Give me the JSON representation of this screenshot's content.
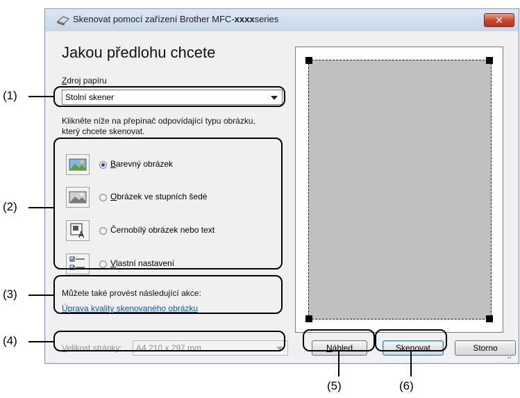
{
  "window": {
    "title_prefix": "Skenovat pomocí zařízení Brother MFC-",
    "title_model": "xxxx",
    "title_suffix": "series",
    "close_glyph": "✕"
  },
  "heading": "Jakou předlohu chcete",
  "paper_source": {
    "label": "Zdroj papíru",
    "selected": "Stolní skener"
  },
  "instruction": {
    "line1": "Klikněte níže na přepínač odpovídající typu obrázku,",
    "line2": "který chcete skenovat."
  },
  "image_types": [
    {
      "label": "Barevný obrázek",
      "icon": "color-photo-icon",
      "checked": true
    },
    {
      "label": "Obrázek ve stupních šedé",
      "icon": "grayscale-photo-icon",
      "checked": false
    },
    {
      "label": "Černobílý obrázek nebo text",
      "icon": "black-white-text-icon",
      "checked": false
    },
    {
      "label": "Vlastní nastavení",
      "icon": "custom-settings-icon",
      "checked": false
    }
  ],
  "actions": {
    "intro": "Můžete také provést následující akce:",
    "link": "Úprava kvality skenovaného obrázku"
  },
  "page_size": {
    "label": "Velikost stránky:",
    "value": "A4 210 x 297 mm"
  },
  "buttons": {
    "preview": "Náhled",
    "scan": "Skenovat",
    "cancel": "Storno"
  },
  "callouts": {
    "c1": "(1)",
    "c2": "(2)",
    "c3": "(3)",
    "c4": "(4)",
    "c5": "(5)",
    "c6": "(6)"
  }
}
